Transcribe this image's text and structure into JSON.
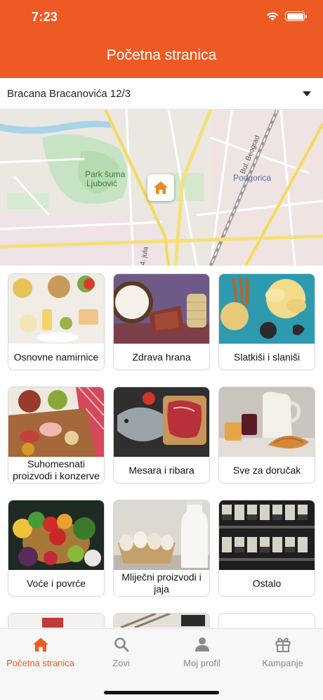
{
  "status_bar": {
    "time": "7:23"
  },
  "header": {
    "title": "Početna stranica"
  },
  "address": {
    "value": "Bracana Bracanovića 12/3"
  },
  "map": {
    "labels": {
      "park": "Park šuma Ljubović",
      "park_line1": "Park šuma",
      "park_line2": "Ljubović",
      "city": "Podgorica",
      "street_beograd": "Bul. Beograd",
      "street_4jula": "4. jula"
    }
  },
  "categories": [
    {
      "label": "Osnovne namirnice",
      "icon": "pantry-staples-photo"
    },
    {
      "label": "Zdrava hrana",
      "icon": "healthy-food-photo"
    },
    {
      "label": "Slatkiši i slaniši",
      "icon": "snacks-photo"
    },
    {
      "label": "Suhomesnati proizvodi i konzerve",
      "icon": "cured-meat-photo"
    },
    {
      "label": "Mesara i ribara",
      "icon": "meat-fish-photo"
    },
    {
      "label": "Sve za doručak",
      "icon": "breakfast-photo"
    },
    {
      "label": "Voće i povrće",
      "icon": "fruit-vegetables-photo"
    },
    {
      "label": "Mliječni proizvodi i jaja",
      "icon": "dairy-eggs-photo"
    },
    {
      "label": "Ostalo",
      "icon": "other-products-photo"
    }
  ],
  "tabbar": {
    "tabs": [
      {
        "label": "Početna stranica",
        "icon": "home-icon",
        "active": true
      },
      {
        "label": "Zovi",
        "icon": "search-icon",
        "active": false
      },
      {
        "label": "Moj profil",
        "icon": "person-icon",
        "active": false
      },
      {
        "label": "Kampanje",
        "icon": "gift-icon",
        "active": false
      }
    ]
  },
  "colors": {
    "accent": "#ee5a24",
    "inactive": "#8a8a8a"
  }
}
